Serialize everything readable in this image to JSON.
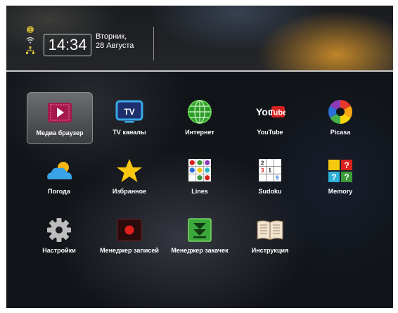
{
  "header": {
    "time": "14:34",
    "weekday": "Вторник,",
    "date": "28 Августа"
  },
  "apps": [
    {
      "label": "Медиа браузер",
      "icon": "media-browser-icon"
    },
    {
      "label": "TV каналы",
      "icon": "tv-icon",
      "icon_text": "TV"
    },
    {
      "label": "Интернет",
      "icon": "globe-icon"
    },
    {
      "label": "YouTube",
      "icon": "youtube-icon",
      "icon_text_you": "You",
      "icon_text_tube": "Tube"
    },
    {
      "label": "Picasa",
      "icon": "picasa-icon"
    },
    {
      "label": "Погода",
      "icon": "weather-icon"
    },
    {
      "label": "Избранное",
      "icon": "star-icon"
    },
    {
      "label": "Lines",
      "icon": "lines-game-icon"
    },
    {
      "label": "Sudoku",
      "icon": "sudoku-icon",
      "icon_digits": [
        "2",
        "3",
        "1",
        "9"
      ]
    },
    {
      "label": "Memory",
      "icon": "memory-game-icon",
      "icon_marks": [
        "?",
        "?",
        "?"
      ]
    },
    {
      "label": "Настройки",
      "icon": "gear-icon"
    },
    {
      "label": "Менеджер записей",
      "icon": "record-icon"
    },
    {
      "label": "Менеджер закачек",
      "icon": "download-icon"
    },
    {
      "label": "Инструкция",
      "icon": "book-icon"
    }
  ],
  "selected_app": "Медиа браузер"
}
